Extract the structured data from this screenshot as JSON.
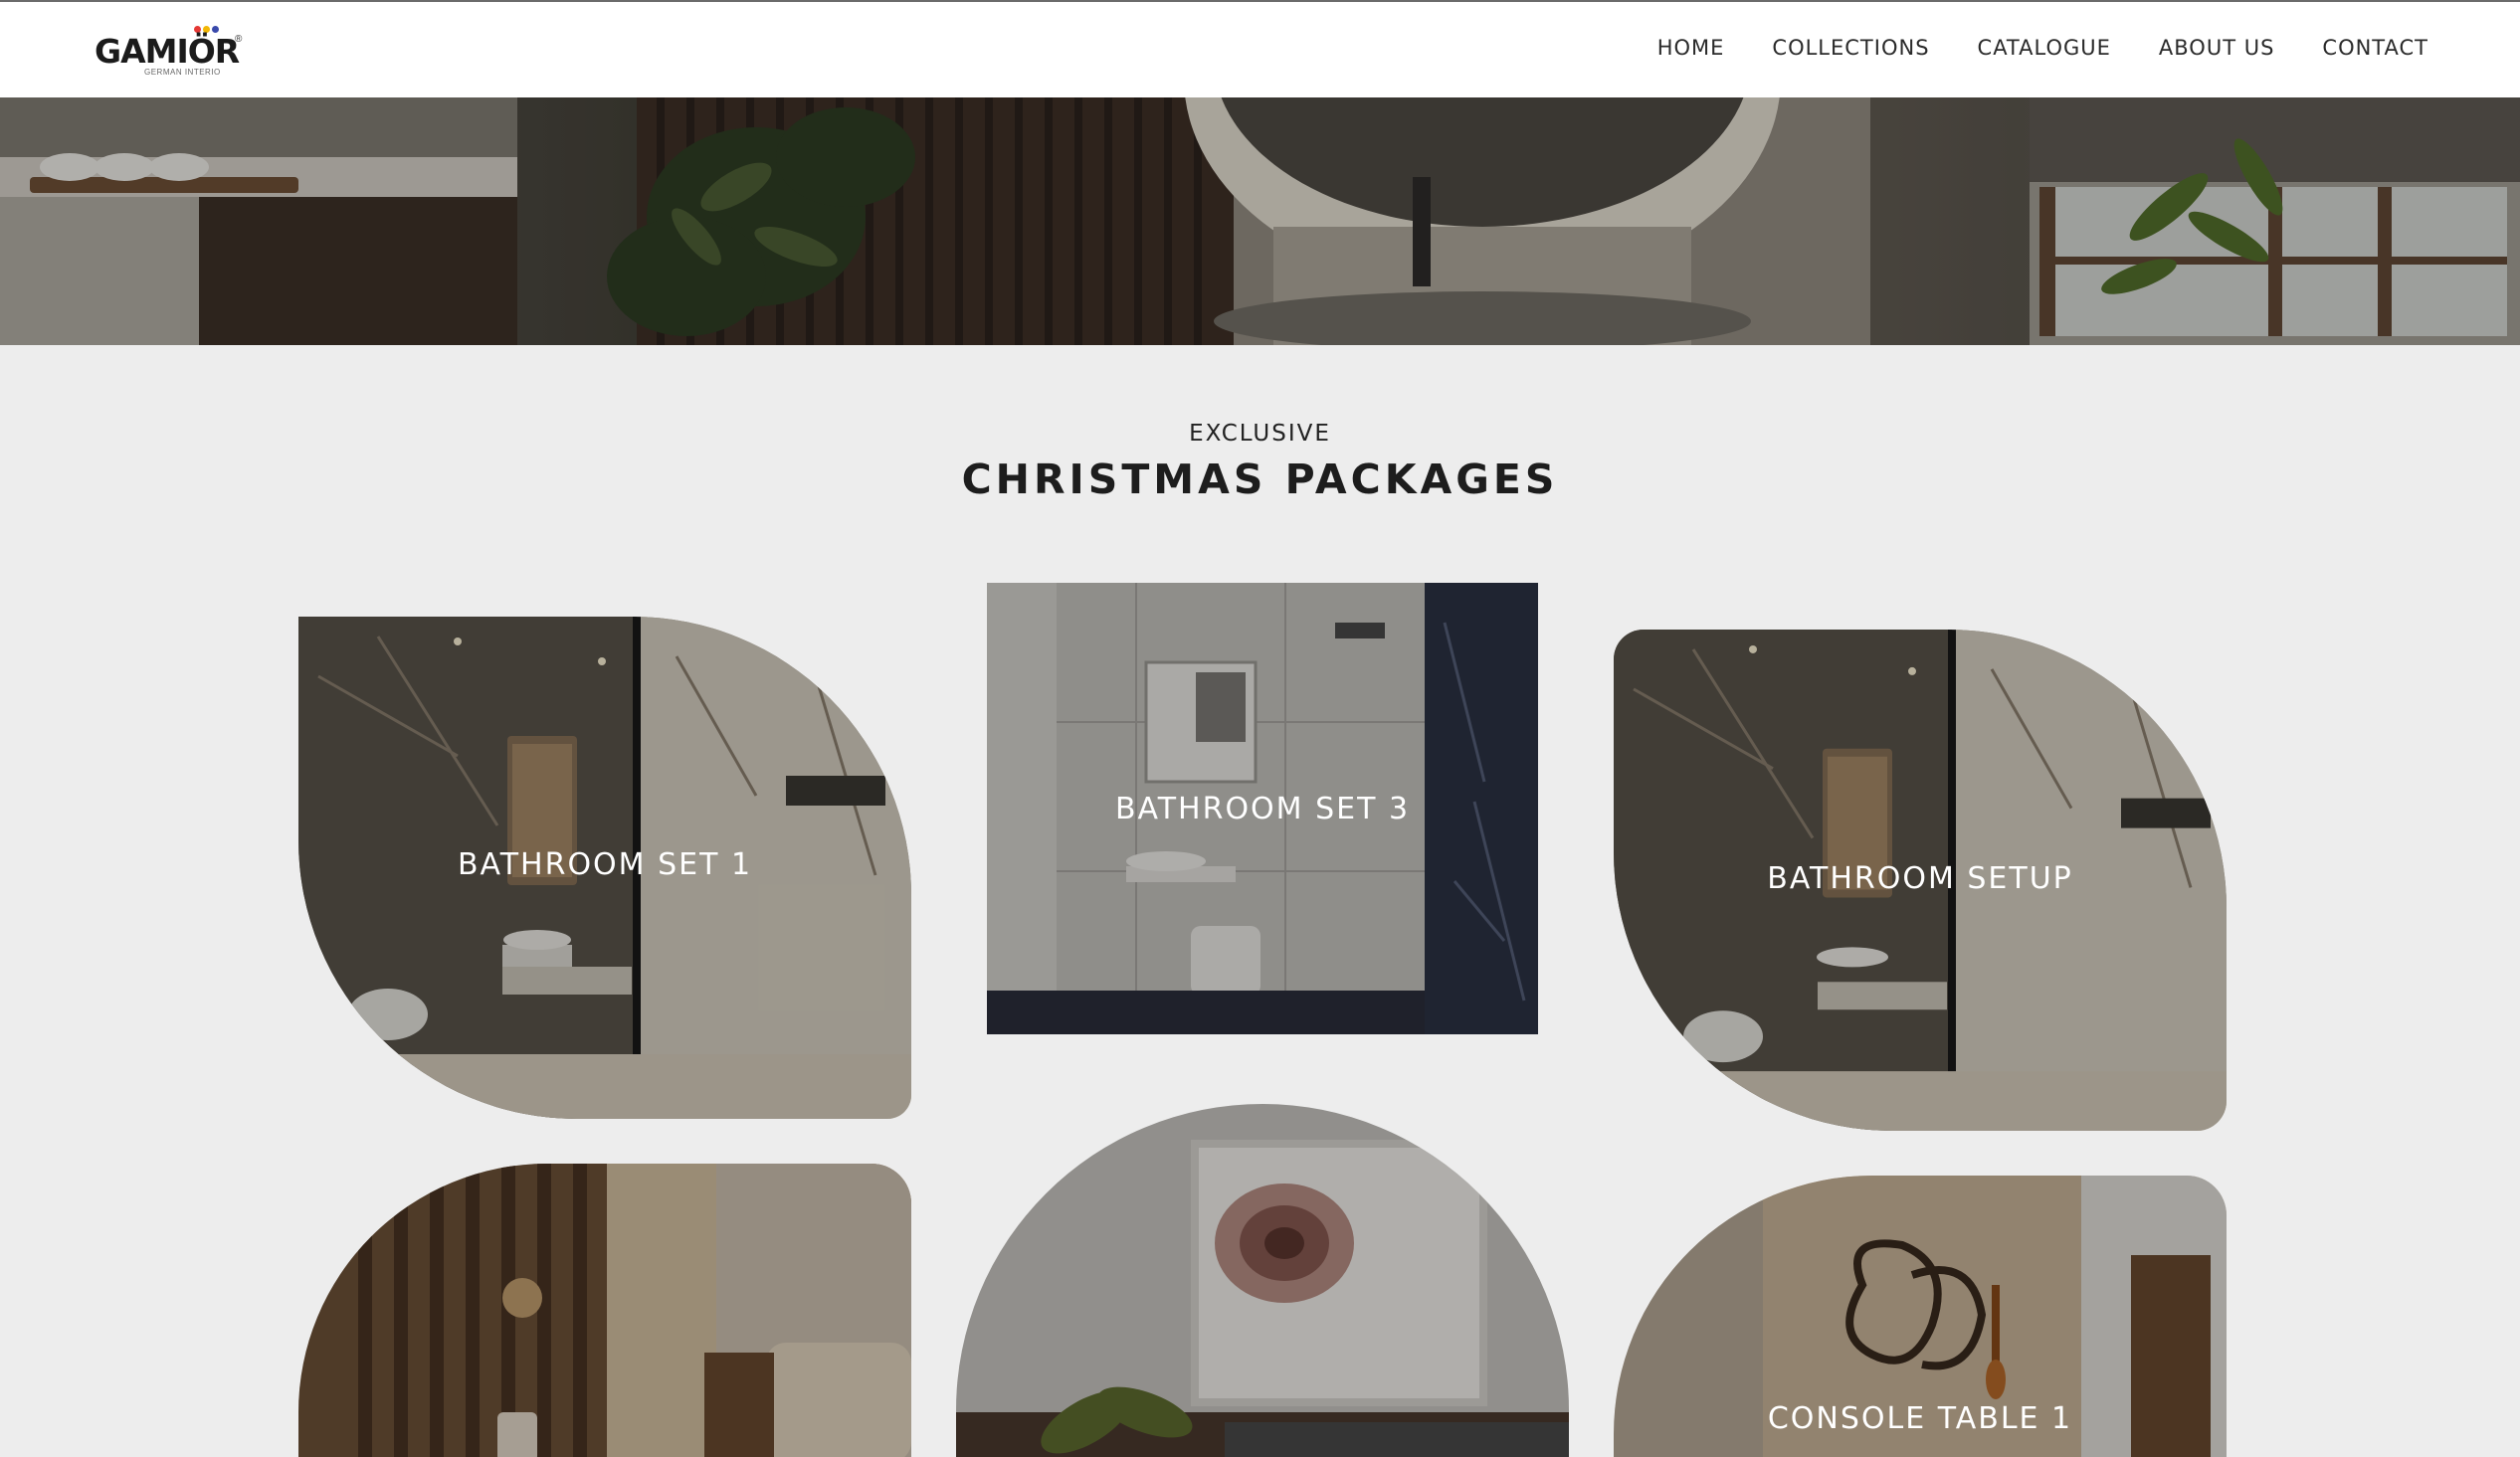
{
  "header": {
    "logo": {
      "wordmark": "GAMIÖR",
      "registered": "®",
      "tagline": "GERMAN INTERIO",
      "dot_colors": [
        "#e53935",
        "#f2b705",
        "#3949ab"
      ]
    },
    "nav": [
      "HOME",
      "COLLECTIONS",
      "CATALOGUE",
      "ABOUT US",
      "CONTACT"
    ]
  },
  "hero": {
    "slides": 4,
    "active_slide": 2
  },
  "section": {
    "eyebrow": "EXCLUSIVE",
    "title": "CHRISTMAS PACKAGES"
  },
  "cards": [
    {
      "label": "BATHROOM SET 1",
      "image": "bathroom-marble"
    },
    {
      "label": "BATHROOM SET 3",
      "image": "bathroom-white-tiles"
    },
    {
      "label": "BATHROOM SETUP",
      "image": "bathroom-marble"
    },
    {
      "label": "",
      "image": "bedroom-wood-slats"
    },
    {
      "label": "",
      "image": "bedroom-rose-art"
    },
    {
      "label": "CONSOLE TABLE 1",
      "image": "console-mirror"
    }
  ],
  "colors": {
    "background": "#ededed",
    "header": "#ffffff",
    "text": "#1d1d1d"
  }
}
